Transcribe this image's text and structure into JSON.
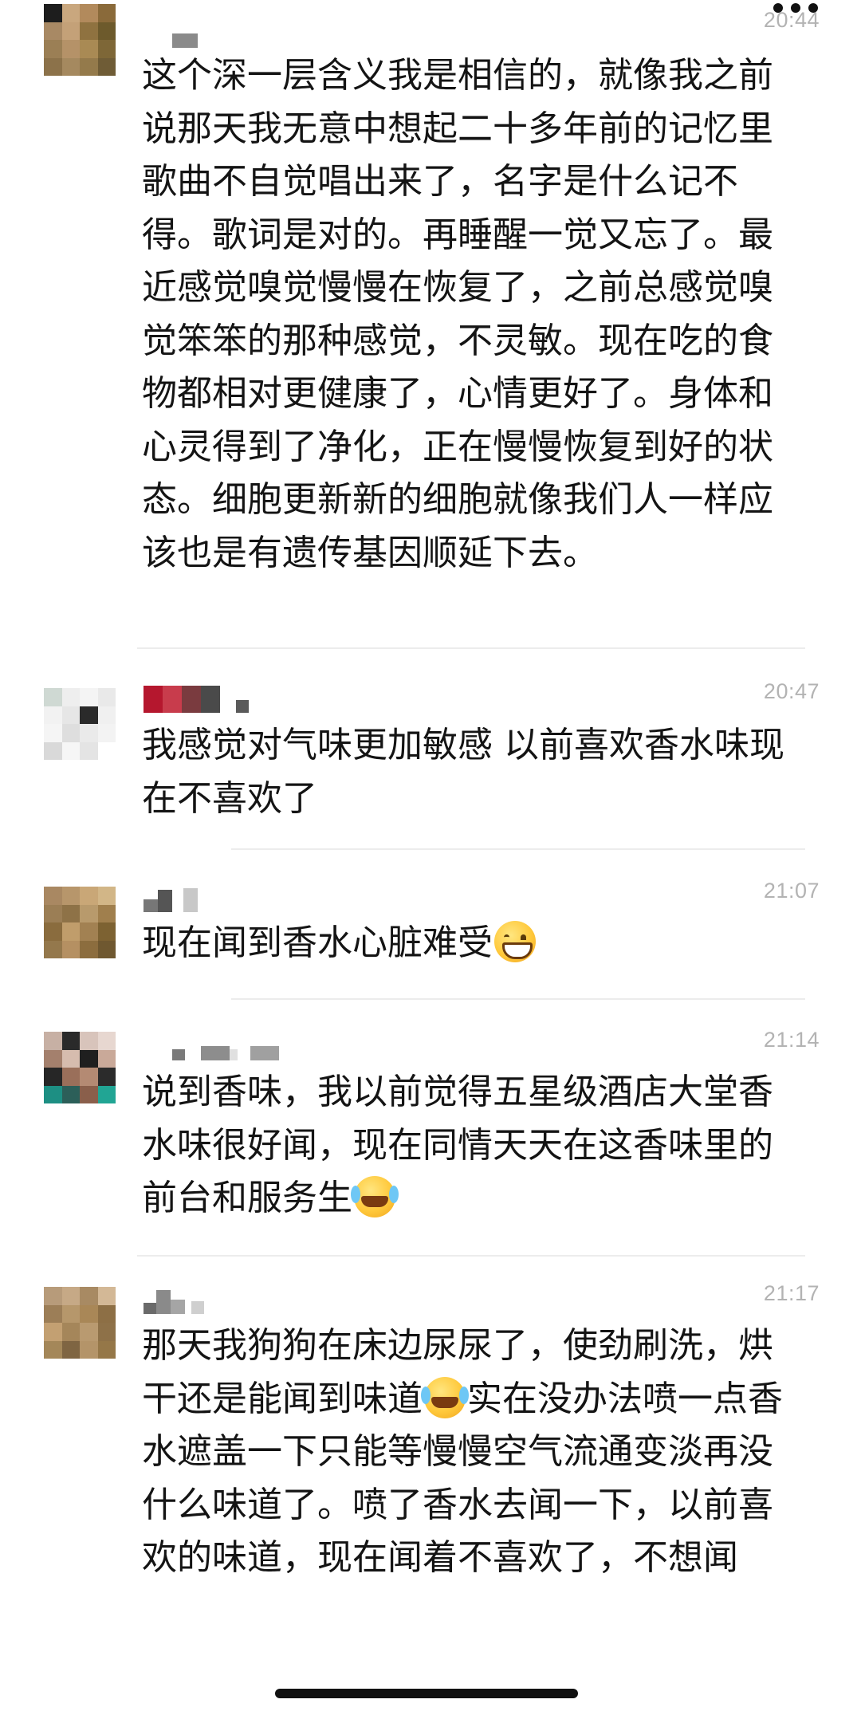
{
  "header": {
    "more_icon": "more-dots-icon"
  },
  "comments": [
    {
      "time": "20:44",
      "text": "这个深一层含义我是相信的，就像我之前说那天我无意中想起二十多年前的记忆里歌曲不自觉唱出来了，名字是什么记不得。歌词是对的。再睡醒一觉又忘了。最近感觉嗅觉慢慢在恢复了，之前总感觉嗅觉笨笨的那种感觉，不灵敏。现在吃的食物都相对更健康了，心情更好了。身体和心灵得到了净化，正在慢慢恢复到好的状态。细胞更新新的细胞就像我们人一样应该也是有遗传基因顺延下去。"
    },
    {
      "time": "20:47",
      "text": "我感觉对气味更加敏感 以前喜欢香水味现在不喜欢了"
    },
    {
      "time": "21:07",
      "text": "现在闻到香水心脏难受",
      "emoji": "grinning-face-icon"
    },
    {
      "time": "21:14",
      "text_a": "说到香味，我以前觉得五星级酒店大堂香水味很好闻，现在同情天天在这香味里的前台和服务生",
      "emoji": "crying-face-icon"
    },
    {
      "time": "21:17",
      "text_a": "那天我狗狗在床边尿尿了，使劲刷洗，烘干还是能闻到味道",
      "emoji": "crying-face-icon",
      "text_b": "实在没办法喷一点香水遮盖一下只能等慢慢空气流通变淡再没什么味道了。喷了香水去闻一下，以前喜欢的味道，现在闻着不喜欢了，不想闻"
    }
  ]
}
